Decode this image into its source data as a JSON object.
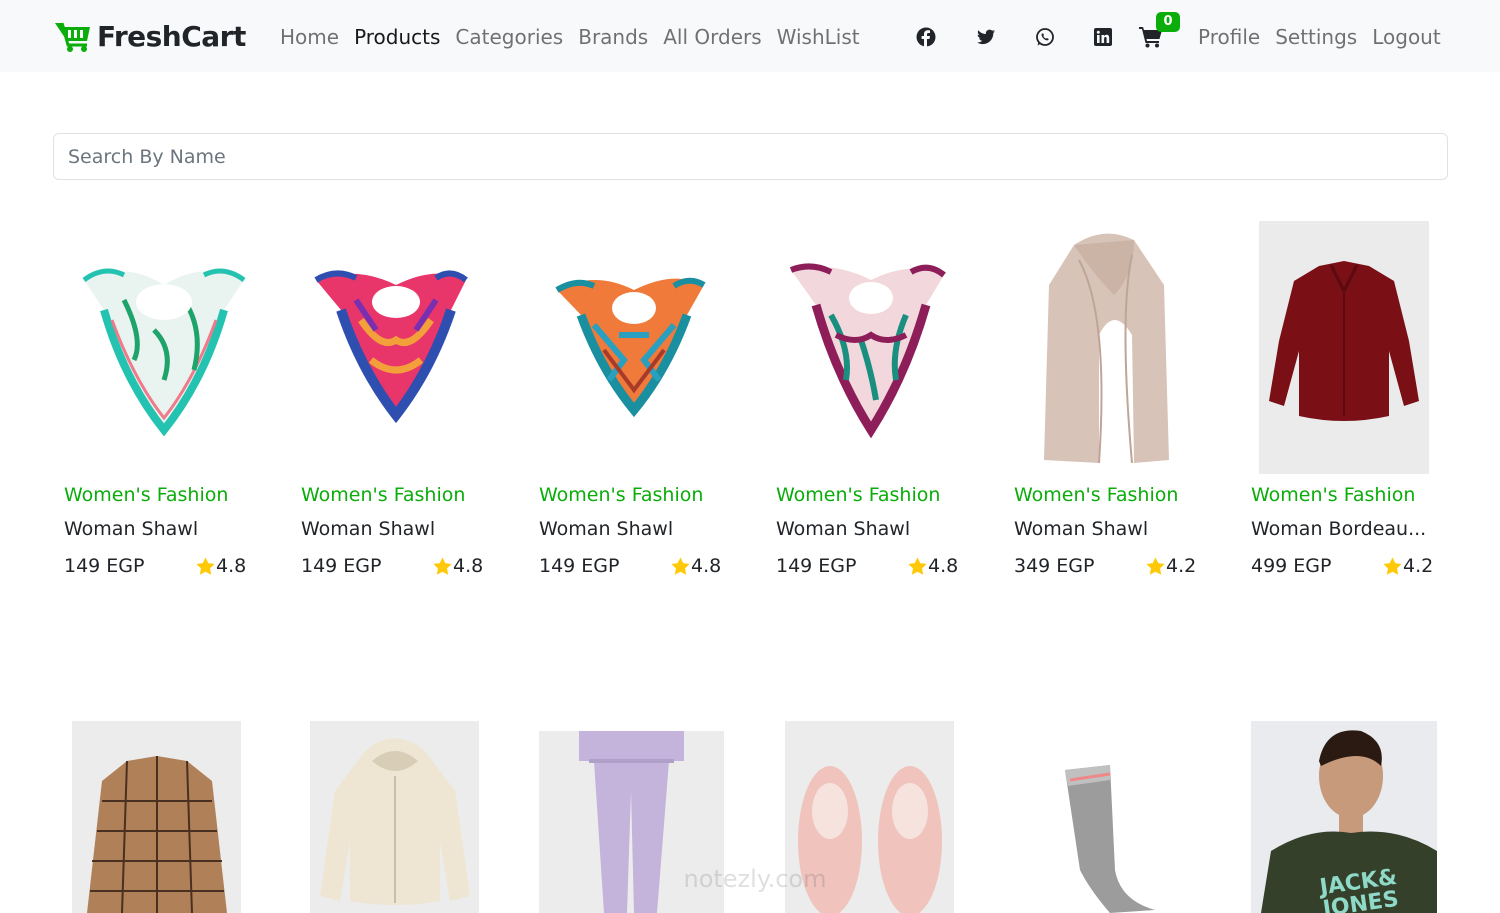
{
  "brand": {
    "name": "FreshCart",
    "accent_color": "#0aad0a"
  },
  "nav": {
    "links": [
      {
        "label": "Home",
        "active": false
      },
      {
        "label": "Products",
        "active": true
      },
      {
        "label": "Categories",
        "active": false
      },
      {
        "label": "Brands",
        "active": false
      },
      {
        "label": "All Orders",
        "active": false
      },
      {
        "label": "WishList",
        "active": false
      }
    ],
    "social_icons": [
      "facebook-icon",
      "twitter-icon",
      "whatsapp-icon",
      "linkedin-icon"
    ],
    "cart_count": "0",
    "right_links": [
      "Profile",
      "Settings",
      "Logout"
    ]
  },
  "search": {
    "placeholder": "Search By Name",
    "value": ""
  },
  "products": [
    {
      "category": "Women's Fashion",
      "title": "Woman Shawl",
      "price": "149 EGP",
      "rating": "4.8",
      "image": "scarf-white-green"
    },
    {
      "category": "Women's Fashion",
      "title": "Woman Shawl",
      "price": "149 EGP",
      "rating": "4.8",
      "image": "scarf-pink-blue"
    },
    {
      "category": "Women's Fashion",
      "title": "Woman Shawl",
      "price": "149 EGP",
      "rating": "4.8",
      "image": "scarf-orange-teal"
    },
    {
      "category": "Women's Fashion",
      "title": "Woman Shawl",
      "price": "149 EGP",
      "rating": "4.8",
      "image": "scarf-purple-pink"
    },
    {
      "category": "Women's Fashion",
      "title": "Woman Shawl",
      "price": "349 EGP",
      "rating": "4.2",
      "image": "scarf-beige"
    },
    {
      "category": "Women's Fashion",
      "title": "Woman Bordeau...",
      "price": "499 EGP",
      "rating": "4.2",
      "image": "bordeaux-shirt"
    }
  ],
  "second_row_images": [
    "plaid-shirt",
    "cream-hoodie",
    "lilac-tracksuit",
    "pink-slippers",
    "grey-sock",
    "green-tshirt"
  ],
  "second_row_texts": {
    "tshirt_print": "JACK& JONES"
  },
  "watermark": {
    "text": "notezly.com"
  }
}
